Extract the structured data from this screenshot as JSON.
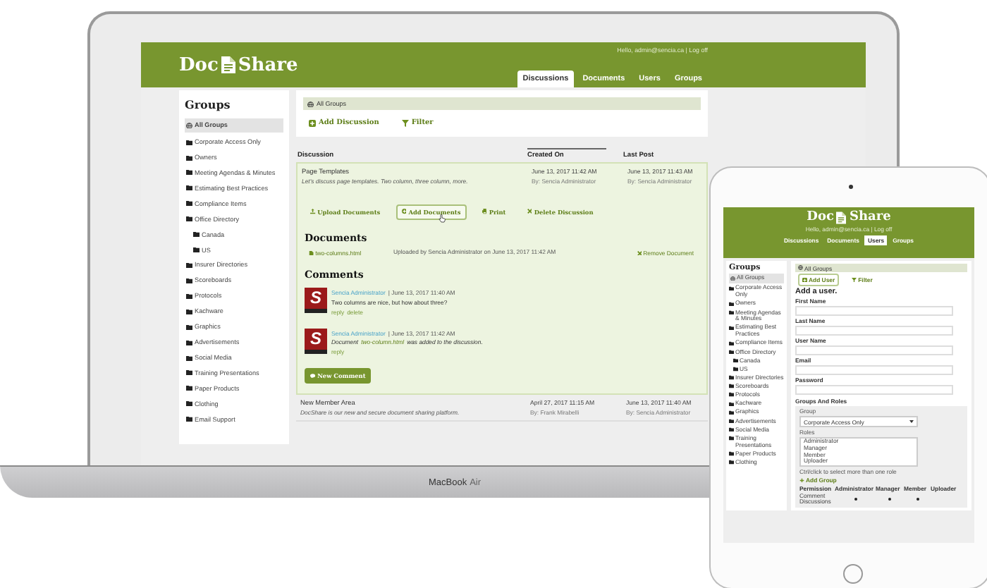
{
  "laptop": {
    "brand": "MacBook",
    "model": "Air",
    "app": {
      "logo": {
        "left": "Doc",
        "right": "Share"
      },
      "greeting": "Hello, admin@sencia.ca | Log off",
      "tabs": [
        {
          "label": "Discussions",
          "selected": true
        },
        {
          "label": "Documents",
          "selected": false
        },
        {
          "label": "Users",
          "selected": false
        },
        {
          "label": "Groups",
          "selected": false
        }
      ],
      "sidebar": {
        "title": "Groups",
        "items": [
          {
            "label": "All Groups",
            "kind": "all",
            "selected": true
          },
          {
            "label": "Corporate Access Only",
            "kind": "folder",
            "selected": false
          },
          {
            "label": "Owners",
            "kind": "folder",
            "selected": false
          },
          {
            "label": "Meeting Agendas & Minutes",
            "kind": "folder",
            "selected": false
          },
          {
            "label": "Estimating Best Practices",
            "kind": "folder",
            "selected": false
          },
          {
            "label": "Compliance Items",
            "kind": "folder",
            "selected": false
          },
          {
            "label": "Office Directory",
            "kind": "folder",
            "selected": false,
            "children": [
              {
                "label": "Canada",
                "kind": "folder",
                "selected": false
              },
              {
                "label": "US",
                "kind": "folder",
                "selected": false
              }
            ]
          },
          {
            "label": "Insurer Directories",
            "kind": "folder",
            "selected": false
          },
          {
            "label": "Scoreboards",
            "kind": "folder",
            "selected": false
          },
          {
            "label": "Protocols",
            "kind": "folder",
            "selected": false
          },
          {
            "label": "Kachware",
            "kind": "folder",
            "selected": false
          },
          {
            "label": "Graphics",
            "kind": "folder",
            "selected": false
          },
          {
            "label": "Advertisements",
            "kind": "folder",
            "selected": false
          },
          {
            "label": "Social Media",
            "kind": "folder",
            "selected": false
          },
          {
            "label": "Training Presentations",
            "kind": "folder",
            "selected": false
          },
          {
            "label": "Paper Products",
            "kind": "folder",
            "selected": false
          },
          {
            "label": "Clothing",
            "kind": "folder",
            "selected": false
          },
          {
            "label": "Email Support",
            "kind": "folder",
            "selected": false
          }
        ]
      },
      "breadcrumb": "All Groups",
      "actions": [
        {
          "label": "Add Discussion",
          "kind": "add",
          "selected": false
        },
        {
          "label": "Filter",
          "kind": "filter",
          "selected": false
        }
      ],
      "table": {
        "columns": [
          {
            "label": "Discussion",
            "sorted": false
          },
          {
            "label": "Created On",
            "sorted": true
          },
          {
            "label": "Last Post",
            "sorted": false
          }
        ],
        "rows": [
          {
            "title": "Page Templates",
            "description": "Let's discuss page templates. Two column, three column, more.",
            "created": "June 13, 2017 11:42 AM",
            "created_by": "By: Sencia Administrator",
            "last_post": "June 13, 2017 11:43 AM",
            "last_by": "By: Sencia Administrator",
            "expanded": true,
            "details": {
              "actions": [
                {
                  "label": "Upload Documents",
                  "kind": "upload",
                  "hovered": false
                },
                {
                  "label": "Add Documents",
                  "kind": "add",
                  "hovered": true
                },
                {
                  "label": "Print",
                  "kind": "print",
                  "hovered": false
                },
                {
                  "label": "Delete Discussion",
                  "kind": "delete",
                  "hovered": false
                }
              ],
              "documents_heading": "Documents",
              "documents": [
                {
                  "name": "two-columns.html",
                  "uploaded": "Uploaded by Sencia Administrator on June 13, 2017 11:42 AM",
                  "remove": "Remove Document"
                }
              ],
              "comments_heading": "Comments",
              "comments": [
                {
                  "kind": "message",
                  "avatar": "S",
                  "author": "Sencia Administrator",
                  "date": "| June 13, 2017 11:40 AM",
                  "text": "Two columns are nice, but how about three?",
                  "links": [
                    "reply",
                    "delete"
                  ]
                },
                {
                  "kind": "note",
                  "avatar": "S",
                  "author": "Sencia Administrator",
                  "date": "| June 13, 2017 11:42 AM",
                  "text": "Document",
                  "link": "two-column.html",
                  "text_after": "was added to the discussion.",
                  "links": [
                    "reply"
                  ]
                }
              ],
              "new_comment": "New Comment"
            }
          },
          {
            "title": "New Member Area",
            "description": "DocShare is our new and secure document sharing platform.",
            "created": "April 27, 2017 11:15 AM",
            "created_by": "By: Frank Mirabelli",
            "last_post": "June 13, 2017 11:40 AM",
            "last_by": "By: Sencia Administrator",
            "expanded": false
          }
        ]
      }
    }
  },
  "tablet": {
    "app": {
      "logo": {
        "left": "Doc",
        "right": "Share"
      },
      "greeting": "Hello, admin@sencia.ca | Log off",
      "tabs": [
        {
          "label": "Discussions",
          "selected": false
        },
        {
          "label": "Documents",
          "selected": false
        },
        {
          "label": "Users",
          "selected": true
        },
        {
          "label": "Groups",
          "selected": false
        }
      ],
      "sidebar": {
        "title": "Groups",
        "items": [
          {
            "label": "All Groups",
            "kind": "all",
            "selected": true
          },
          {
            "label": "Corporate Access Only",
            "kind": "folder",
            "selected": false
          },
          {
            "label": "Owners",
            "kind": "folder",
            "selected": false
          },
          {
            "label": "Meeting Agendas & Minutes",
            "kind": "folder",
            "selected": false
          },
          {
            "label": "Estimating Best Practices",
            "kind": "folder",
            "selected": false
          },
          {
            "label": "Compliance Items",
            "kind": "folder",
            "selected": false
          },
          {
            "label": "Office Directory",
            "kind": "folder",
            "selected": false,
            "children": [
              {
                "label": "Canada",
                "kind": "folder",
                "selected": false
              },
              {
                "label": "US",
                "kind": "folder",
                "selected": false
              }
            ]
          },
          {
            "label": "Insurer Directories",
            "kind": "folder",
            "selected": false
          },
          {
            "label": "Scoreboards",
            "kind": "folder",
            "selected": false
          },
          {
            "label": "Protocols",
            "kind": "folder",
            "selected": false
          },
          {
            "label": "Kachware",
            "kind": "folder",
            "selected": false
          },
          {
            "label": "Graphics",
            "kind": "folder",
            "selected": false
          },
          {
            "label": "Advertisements",
            "kind": "folder",
            "selected": false
          },
          {
            "label": "Social Media",
            "kind": "folder",
            "selected": false
          },
          {
            "label": "Training Presentations",
            "kind": "folder",
            "selected": false
          },
          {
            "label": "Paper Products",
            "kind": "folder",
            "selected": false
          },
          {
            "label": "Clothing",
            "kind": "folder",
            "selected": false
          }
        ]
      },
      "breadcrumb": "All Groups",
      "actions": [
        {
          "label": "Add User",
          "kind": "add",
          "selected": true
        },
        {
          "label": "Filter",
          "kind": "filter",
          "selected": false
        }
      ],
      "form": {
        "heading": "Add a user.",
        "fields": [
          {
            "label": "First Name"
          },
          {
            "label": "Last Name"
          },
          {
            "label": "User Name"
          },
          {
            "label": "Email"
          },
          {
            "label": "Password"
          }
        ],
        "roles_section": {
          "heading": "Groups And Roles",
          "group_label": "Group",
          "group_value": "Corporate Access Only",
          "roles_label": "Roles",
          "roles": [
            "Administrator",
            "Manager",
            "Member",
            "Uploader"
          ],
          "hint": "Ctrl/click to select more than one role",
          "add_group": "Add Group"
        },
        "permissions": {
          "columns": [
            "Permission",
            "Administrator",
            "Manager",
            "Member",
            "Uploader"
          ],
          "rows": [
            {
              "name": "Comment Discussions",
              "granted": [
                true,
                true,
                true,
                false
              ]
            }
          ]
        }
      }
    }
  }
}
